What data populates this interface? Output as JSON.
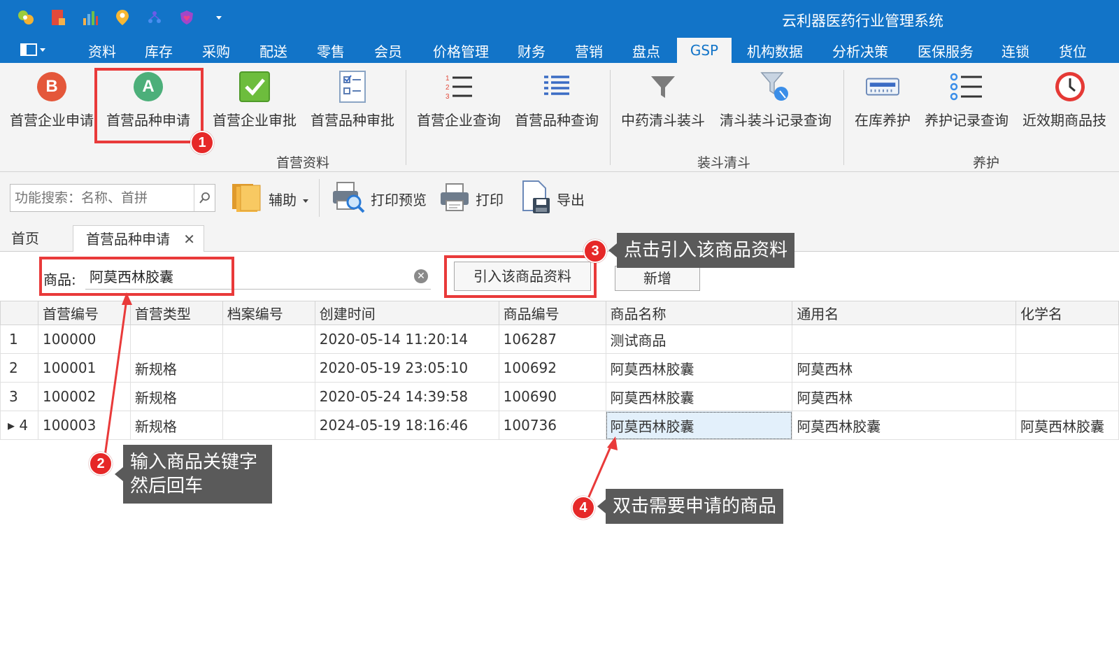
{
  "app": {
    "title": "云利器医药行业管理系统"
  },
  "menu": {
    "tabs": [
      "资料",
      "库存",
      "采购",
      "配送",
      "零售",
      "会员",
      "价格管理",
      "财务",
      "营销",
      "盘点",
      "GSP",
      "机构数据",
      "分析决策",
      "医保服务",
      "连锁",
      "货位"
    ],
    "active": "GSP"
  },
  "ribbon": {
    "buttons": [
      "首营企业申请",
      "首营品种申请",
      "首营企业审批",
      "首营品种审批",
      "首营企业查询",
      "首营品种查询",
      "中药清斗装斗",
      "清斗装斗记录查询",
      "在库养护",
      "养护记录查询",
      "近效期商品技"
    ],
    "groups": [
      "首营资料",
      "装斗清斗",
      "养护"
    ],
    "icon_letters": {
      "b": "B",
      "a": "A"
    }
  },
  "toolbar": {
    "search_placeholder": "功能搜索：名称、首拼",
    "assist": "辅助",
    "print_preview": "打印预览",
    "print": "打印",
    "export": "导出"
  },
  "doctabs": {
    "home": "首页",
    "current": "首营品种申请",
    "close": "✕"
  },
  "filter": {
    "label": "商品:",
    "value": "阿莫西林胶囊",
    "import_button": "引入该商品资料",
    "new_button": "新增"
  },
  "grid": {
    "columns": [
      "首营编号",
      "首营类型",
      "档案编号",
      "创建时间",
      "商品编号",
      "商品名称",
      "通用名",
      "化学名"
    ],
    "rows": [
      {
        "num": "1",
        "id": "100000",
        "type": "",
        "archive": "",
        "created": "2020-05-14 11:20:14",
        "code": "106287",
        "name": "测试商品",
        "generic": "",
        "chem": ""
      },
      {
        "num": "2",
        "id": "100001",
        "type": "新规格",
        "archive": "",
        "created": "2020-05-19 23:05:10",
        "code": "100692",
        "name": "阿莫西林胶囊",
        "generic": "阿莫西林",
        "chem": ""
      },
      {
        "num": "3",
        "id": "100002",
        "type": "新规格",
        "archive": "",
        "created": "2020-05-24 14:39:58",
        "code": "100690",
        "name": "阿莫西林胶囊",
        "generic": "阿莫西林",
        "chem": ""
      },
      {
        "num": "▸ 4",
        "id": "100003",
        "type": "新规格",
        "archive": "",
        "created": "2024-05-19 18:16:46",
        "code": "100736",
        "name": "阿莫西林胶囊",
        "generic": "阿莫西林胶囊",
        "chem": "阿莫西林胶囊"
      }
    ]
  },
  "annotations": {
    "badges": [
      "1",
      "2",
      "3",
      "4"
    ],
    "callout2_line1": "输入商品关键字",
    "callout2_line2": "然后回车",
    "callout3": "点击引入该商品资料",
    "callout4": "双击需要申请的商品"
  },
  "colors": {
    "brand": "#1274c8",
    "annotation_red": "#e62828",
    "callout_bg": "#5a5a5a"
  }
}
